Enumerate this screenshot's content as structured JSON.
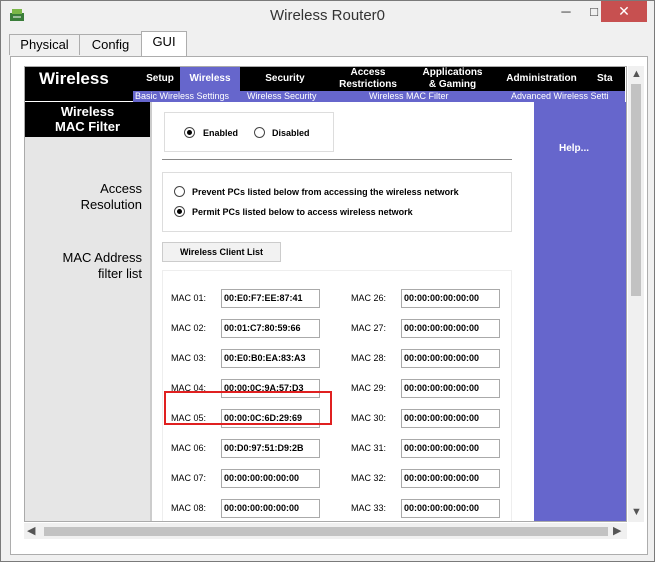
{
  "window": {
    "title": "Wireless Router0",
    "minimize": "─",
    "maximize": "□",
    "close": "✕",
    "app_icon": "packet-tracer-router-icon"
  },
  "tabs": [
    {
      "label": "Physical"
    },
    {
      "label": "Config"
    },
    {
      "label": "GUI"
    }
  ],
  "header": {
    "brand": "Wireless",
    "nav": [
      {
        "label": "Setup"
      },
      {
        "label": "Wireless"
      },
      {
        "label": "Access Restrictions"
      },
      {
        "label": "Applications & Gaming"
      },
      {
        "label": "Administration"
      },
      {
        "label": "Sta"
      }
    ],
    "subnav": [
      {
        "label": "Basic Wireless Settings"
      },
      {
        "label": "Wireless Security"
      },
      {
        "label": "Wireless MAC Filter"
      },
      {
        "label": "Advanced Wireless Setti"
      }
    ]
  },
  "sidebar": {
    "section_title": "Wireless MAC Filter",
    "access_resolution": "Access Resolution",
    "mac_filter_list": "MAC Address filter list"
  },
  "filter": {
    "enabled": "Enabled",
    "disabled": "Disabled",
    "selected": "Enabled"
  },
  "access": {
    "prevent": "Prevent PCs listed below from accessing the wireless network",
    "permit": "Permit PCs listed below to access wireless network",
    "selected": "permit"
  },
  "client_list_button": "Wireless Client List",
  "mac_left": [
    {
      "label": "MAC 01:",
      "value": "00:E0:F7:EE:87:41"
    },
    {
      "label": "MAC 02:",
      "value": "00:01:C7:80:59:66"
    },
    {
      "label": "MAC 03:",
      "value": "00:E0:B0:EA:83:A3"
    },
    {
      "label": "MAC 04:",
      "value": "00:00:0C:9A:57:D3"
    },
    {
      "label": "MAC 05:",
      "value": "00:00:0C:6D:29:69"
    },
    {
      "label": "MAC 06:",
      "value": "00:D0:97:51:D9:2B"
    },
    {
      "label": "MAC 07:",
      "value": "00:00:00:00:00:00"
    },
    {
      "label": "MAC 08:",
      "value": "00:00:00:00:00:00"
    }
  ],
  "mac_right": [
    {
      "label": "MAC 26:",
      "value": "00:00:00:00:00:00"
    },
    {
      "label": "MAC 27:",
      "value": "00:00:00:00:00:00"
    },
    {
      "label": "MAC 28:",
      "value": "00:00:00:00:00:00"
    },
    {
      "label": "MAC 29:",
      "value": "00:00:00:00:00:00"
    },
    {
      "label": "MAC 30:",
      "value": "00:00:00:00:00:00"
    },
    {
      "label": "MAC 31:",
      "value": "00:00:00:00:00:00"
    },
    {
      "label": "MAC 32:",
      "value": "00:00:00:00:00:00"
    },
    {
      "label": "MAC 33:",
      "value": "00:00:00:00:00:00"
    }
  ],
  "help": {
    "label": "Help..."
  },
  "colors": {
    "nav_bg": "#000000",
    "accent": "#6666cc",
    "highlight": "#e02020",
    "close_button": "#c75050"
  }
}
